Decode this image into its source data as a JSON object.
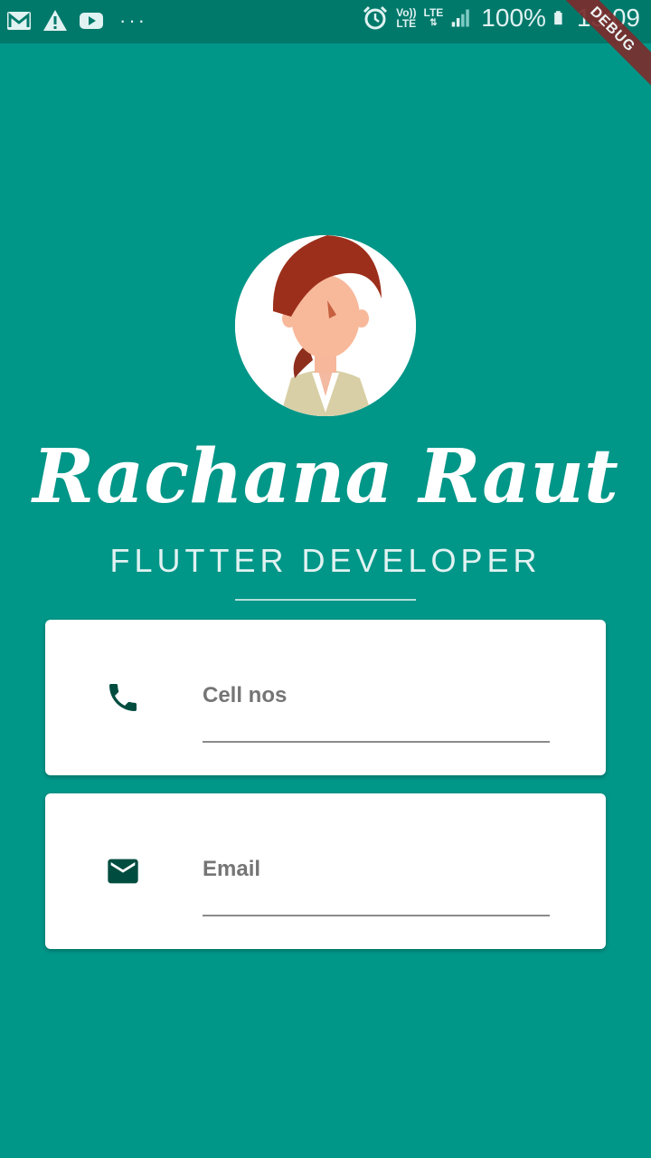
{
  "status_bar": {
    "icons_left": [
      "gmail-icon",
      "warning-icon",
      "youtube-icon"
    ],
    "overflow": "···",
    "alarm_icon": "alarm-icon",
    "volte_top": "Vo))",
    "volte_bottom": "LTE",
    "lte": "LTE",
    "battery": "100%",
    "time": "13:09"
  },
  "debug_banner": "DEBUG",
  "profile": {
    "name": "Rachana Raut",
    "title": "FLUTTER DEVELOPER"
  },
  "cards": {
    "phone": {
      "icon": "phone-icon",
      "placeholder": "Cell nos",
      "value": ""
    },
    "email": {
      "icon": "mail-icon",
      "placeholder": "Email",
      "value": ""
    }
  },
  "colors": {
    "background": "#009688",
    "status_bar": "#00796b",
    "icon": "#004d40",
    "card": "#ffffff"
  }
}
